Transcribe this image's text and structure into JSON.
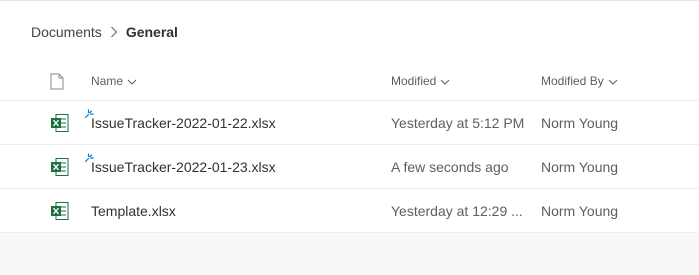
{
  "breadcrumb": {
    "parent": "Documents",
    "current": "General"
  },
  "columns": {
    "name": "Name",
    "modified": "Modified",
    "modified_by": "Modified By"
  },
  "icons": {
    "file_type_header": "document-icon",
    "excel": "excel-file-icon",
    "new": "new-item-badge-icon",
    "sort": "chevron-down-icon",
    "separator": "chevron-right-icon"
  },
  "colors": {
    "excel_green": "#1d6f42",
    "new_badge": "#0078d4"
  },
  "files": [
    {
      "name": "IssueTracker-2022-01-22.xlsx",
      "modified": "Yesterday at 5:12 PM",
      "modified_by": "Norm Young",
      "is_new": true
    },
    {
      "name": "IssueTracker-2022-01-23.xlsx",
      "modified": "A few seconds ago",
      "modified_by": "Norm Young",
      "is_new": true
    },
    {
      "name": "Template.xlsx",
      "modified": "Yesterday at 12:29 ...",
      "modified_by": "Norm Young",
      "is_new": false
    }
  ]
}
